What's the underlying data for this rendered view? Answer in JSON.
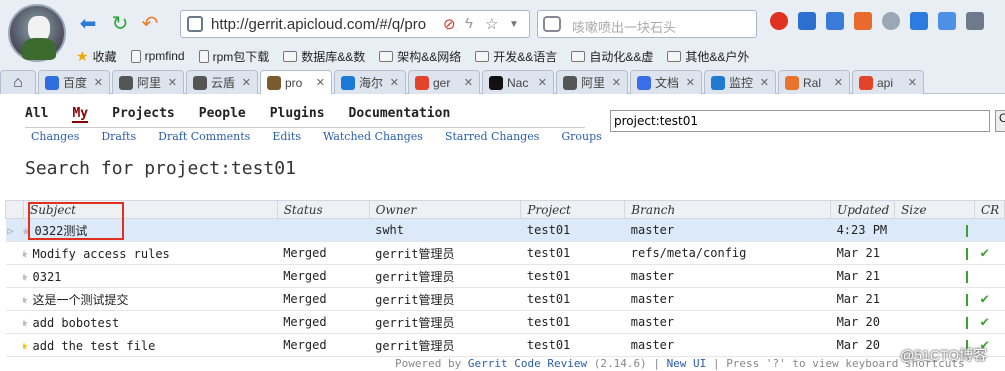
{
  "browser": {
    "url": "http://gerrit.apicloud.com/#/q/pro",
    "search_placeholder": "咳嗽喷出一块石头",
    "bookmarks": [
      {
        "label": "收藏",
        "icon": "star-icon"
      },
      {
        "label": "rpmfind",
        "icon": "page-icon"
      },
      {
        "label": "rpm包下载",
        "icon": "page-icon"
      },
      {
        "label": "数据库&&数",
        "icon": "folder-icon"
      },
      {
        "label": "架构&&网络",
        "icon": "folder-icon"
      },
      {
        "label": "开发&&语言",
        "icon": "folder-icon"
      },
      {
        "label": "自动化&&虚",
        "icon": "folder-icon"
      },
      {
        "label": "其他&&户外",
        "icon": "folder-icon"
      }
    ],
    "tabs": [
      {
        "label": "百度",
        "color": "#2e6ee0"
      },
      {
        "label": "阿里",
        "color": "#555"
      },
      {
        "label": "云盾",
        "color": "#555"
      },
      {
        "label": "pro",
        "color": "#7b5a2e",
        "active": true
      },
      {
        "label": "海尔",
        "color": "#1a7ad6"
      },
      {
        "label": "ger",
        "color": "#e24329"
      },
      {
        "label": "Nac",
        "color": "#111"
      },
      {
        "label": "阿里",
        "color": "#555"
      },
      {
        "label": "文档",
        "color": "#3a6ee8"
      },
      {
        "label": "监控",
        "color": "#1f7bd1"
      },
      {
        "label": "Ral",
        "color": "#e8732c"
      },
      {
        "label": "api",
        "color": "#e24329"
      }
    ]
  },
  "gerrit": {
    "menu": [
      "All",
      "My",
      "Projects",
      "People",
      "Plugins",
      "Documentation"
    ],
    "active_menu": "My",
    "submenu": [
      "Changes",
      "Drafts",
      "Draft Comments",
      "Edits",
      "Watched Changes",
      "Starred Changes",
      "Groups"
    ],
    "query": "project:test01",
    "search_button": "C",
    "page_title": "Search for project:test01",
    "columns": [
      "Subject",
      "Status",
      "Owner",
      "Project",
      "Branch",
      "Updated",
      "Size",
      "CR"
    ],
    "rows": [
      {
        "subject": "0322测试",
        "status": "",
        "owner": "swht",
        "project": "test01",
        "branch": "master",
        "updated": "4:23 PM",
        "starred": false,
        "selected": true,
        "cr": ""
      },
      {
        "subject": "Modify access rules",
        "status": "Merged",
        "owner": "gerrit管理员",
        "project": "test01",
        "branch": "refs/meta/config",
        "updated": "Mar 21",
        "starred": false,
        "selected": false,
        "cr": "✔"
      },
      {
        "subject": "0321",
        "status": "Merged",
        "owner": "gerrit管理员",
        "project": "test01",
        "branch": "master",
        "updated": "Mar 21",
        "starred": false,
        "selected": false,
        "cr": ""
      },
      {
        "subject": "这是一个测试提交",
        "status": "Merged",
        "owner": "gerrit管理员",
        "project": "test01",
        "branch": "master",
        "updated": "Mar 21",
        "starred": false,
        "selected": false,
        "cr": "✔"
      },
      {
        "subject": "add bobotest",
        "status": "Merged",
        "owner": "gerrit管理员",
        "project": "test01",
        "branch": "master",
        "updated": "Mar 20",
        "starred": false,
        "selected": false,
        "cr": "✔"
      },
      {
        "subject": "add the test file",
        "status": "Merged",
        "owner": "gerrit管理员",
        "project": "test01",
        "branch": "master",
        "updated": "Mar 20",
        "starred": true,
        "selected": false,
        "cr": "✔"
      }
    ],
    "footer": {
      "powered": "Powered by",
      "product": "Gerrit Code Review",
      "version": "(2.14.6)",
      "sep": "|",
      "new_ui": "New UI",
      "shortcuts": "Press '?' to view keyboard shortcuts"
    },
    "watermark": "@51CTO博客"
  }
}
